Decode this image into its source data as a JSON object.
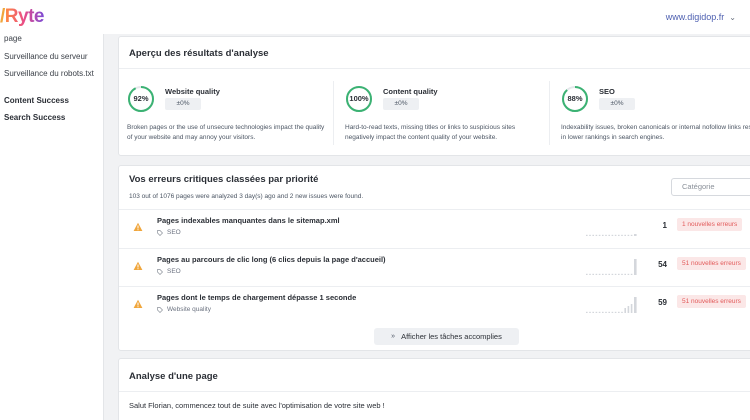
{
  "header": {
    "logo_prefix": "/",
    "logo_text": "Ryte",
    "site": "www.digidop.fr"
  },
  "sidebar": {
    "items": [
      {
        "label": "page"
      },
      {
        "label": "Surveillance du serveur"
      },
      {
        "label": "Surveillance du robots.txt"
      },
      {
        "label": "Content Success"
      },
      {
        "label": "Search Success"
      }
    ]
  },
  "overview": {
    "title": "Aperçu des résultats d'analyse",
    "scores": [
      {
        "name": "Website quality",
        "value": "92%",
        "percent": 92,
        "delta": "±0%",
        "color": "#3bb273",
        "desc": "Broken pages or the use of unsecure technologies impact the quality of your website and may annoy your visitors."
      },
      {
        "name": "Content quality",
        "value": "100%",
        "percent": 100,
        "delta": "±0%",
        "color": "#3bb273",
        "desc": "Hard-to-read texts, missing titles or links to suspicious sites negatively impact the content quality of your website."
      },
      {
        "name": "SEO",
        "value": "88%",
        "percent": 88,
        "delta": "±0%",
        "color": "#3bb273",
        "desc": "Indexability issues, broken canonicals or internal nofollow links result in lower rankings in search engines."
      }
    ]
  },
  "errors": {
    "title": "Vos erreurs critiques classées par priorité",
    "subtitle": "103 out of 1076 pages were analyzed 3 day(s) ago and 2 new issues were found.",
    "category_placeholder": "Catégorie",
    "rows": [
      {
        "title": "Pages indexables manquantes dans le sitemap.xml",
        "tag": "SEO",
        "count": "1",
        "badge": "1 nouvelles erreurs"
      },
      {
        "title": "Pages au parcours de clic long (6 clics depuis la page d'accueil)",
        "tag": "SEO",
        "count": "54",
        "badge": "51 nouvelles erreurs"
      },
      {
        "title": "Pages dont le temps de chargement dépasse 1 seconde",
        "tag": "Website quality",
        "count": "59",
        "badge": "51 nouvelles erreurs"
      }
    ],
    "show_button": "Afficher les tâches accomplies"
  },
  "page_analysis": {
    "title": "Analyse d'une page",
    "greeting": "Salut Florian,  commencez tout de suite avec l'optimisation de votre site web !"
  }
}
